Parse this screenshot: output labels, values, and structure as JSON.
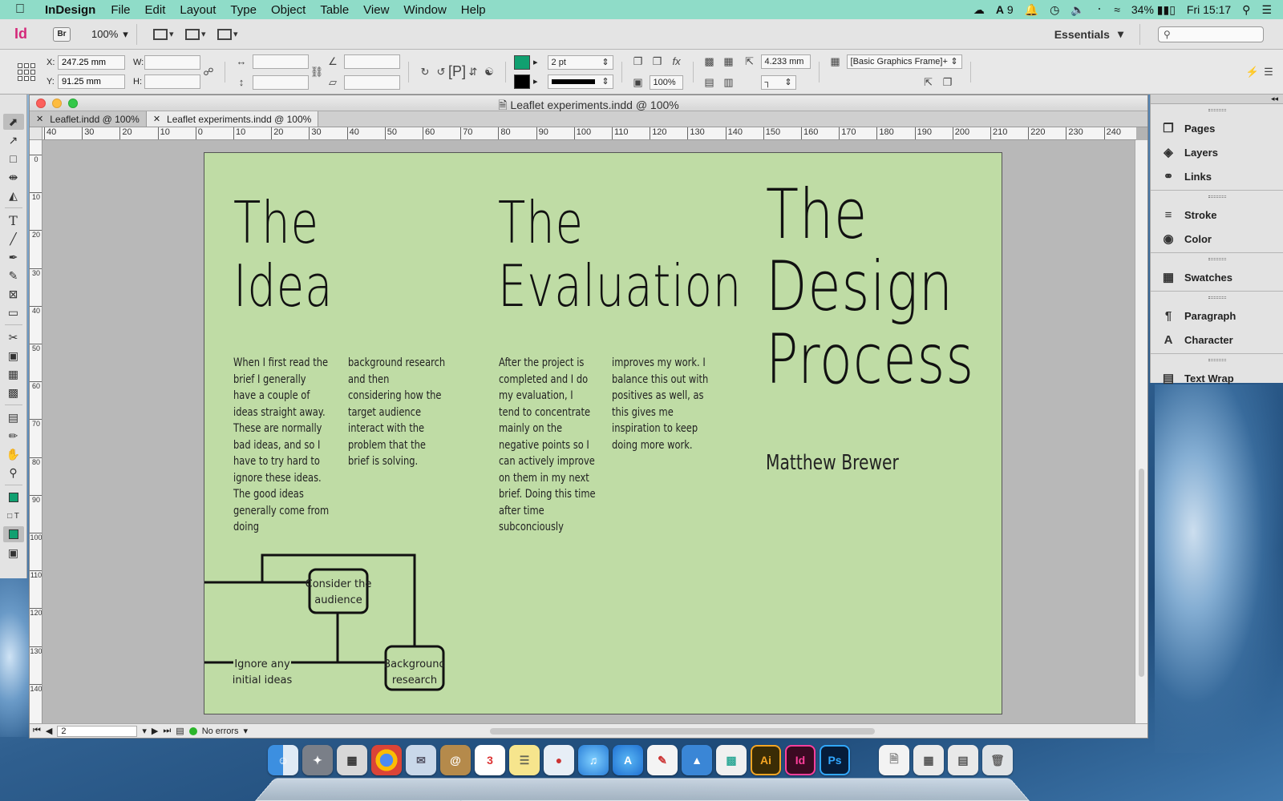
{
  "menubar": {
    "app_name": "InDesign",
    "menus": [
      "File",
      "Edit",
      "Layout",
      "Type",
      "Object",
      "Table",
      "View",
      "Window",
      "Help"
    ],
    "status": {
      "adobe_count": "9",
      "battery": "34%",
      "clock": "Fri 15:17"
    }
  },
  "appbar": {
    "logo": "Id",
    "bridge": "Br",
    "zoom": "100%",
    "workspace": "Essentials"
  },
  "control": {
    "x_label": "X:",
    "y_label": "Y:",
    "w_label": "W:",
    "h_label": "H:",
    "x_value": "247.25 mm",
    "y_value": "91.25 mm",
    "stroke_weight": "2 pt",
    "opacity": "100%",
    "offset": "4.233 mm",
    "object_style": "[Basic Graphics Frame]+",
    "fill_color": "#10a070",
    "stroke_color": "#000000"
  },
  "window": {
    "title": "Leaflet experiments.indd @ 100%",
    "tabs": [
      {
        "label": "Leaflet.indd @ 100%"
      },
      {
        "label": "Leaflet experiments.indd @ 100%"
      }
    ]
  },
  "ruler": {
    "labels": [
      "40",
      "30",
      "20",
      "10",
      "0",
      "10",
      "20",
      "30",
      "40",
      "50",
      "60",
      "70",
      "80",
      "90",
      "100",
      "110",
      "120",
      "130",
      "140",
      "150",
      "160",
      "170",
      "180",
      "190",
      "200",
      "210",
      "220",
      "230",
      "240"
    ],
    "vlabels": [
      "0",
      "10",
      "20",
      "30",
      "40",
      "50",
      "60",
      "70",
      "80",
      "90",
      "100",
      "110",
      "120",
      "130",
      "140"
    ]
  },
  "document": {
    "page_color": "#bfdca5",
    "idea": {
      "title_line1": "The",
      "title_line2": "Idea",
      "col1": "When I first read the brief I generally have a couple of ideas straight away. These are normally bad ideas, and so I have to try hard to ignore these ideas. The good ideas generally come from doing",
      "col2": "background research and then considering how the target audience interact with the problem that the brief is solving."
    },
    "evaluation": {
      "title_line1": "The",
      "title_line2": "Evaluation",
      "col1": "After the project is completed and I do my evaluation, I tend to concentrate mainly on the negative points so I can actively improve on them in my next brief. Doing this time after time subconciously",
      "col2": "improves my work. I balance this out with positives as well, as this gives me inspiration to keep doing more work."
    },
    "design": {
      "line1": "The",
      "line2": "Design",
      "line3": "Process",
      "author": "Matthew Brewer"
    },
    "diagram": {
      "node1_line1": "Consider the",
      "node1_line2": "audience",
      "node2_line1": "Ignore any",
      "node2_line2": "initial ideas",
      "node3_line1": "Background",
      "node3_line2": "research"
    }
  },
  "statusbar": {
    "page": "2",
    "preflight": "No errors"
  },
  "panels": [
    {
      "label": "Pages",
      "icon": "pages-icon"
    },
    {
      "label": "Layers",
      "icon": "layers-icon"
    },
    {
      "label": "Links",
      "icon": "links-icon"
    },
    {
      "label": "Stroke",
      "icon": "stroke-icon"
    },
    {
      "label": "Color",
      "icon": "color-icon"
    },
    {
      "label": "Swatches",
      "icon": "swatches-icon"
    },
    {
      "label": "Paragraph",
      "icon": "paragraph-icon"
    },
    {
      "label": "Character",
      "icon": "character-icon"
    },
    {
      "label": "Text Wrap",
      "icon": "text-wrap-icon"
    }
  ],
  "dock": {
    "ai": "Ai",
    "id": "Id",
    "ps": "Ps"
  }
}
